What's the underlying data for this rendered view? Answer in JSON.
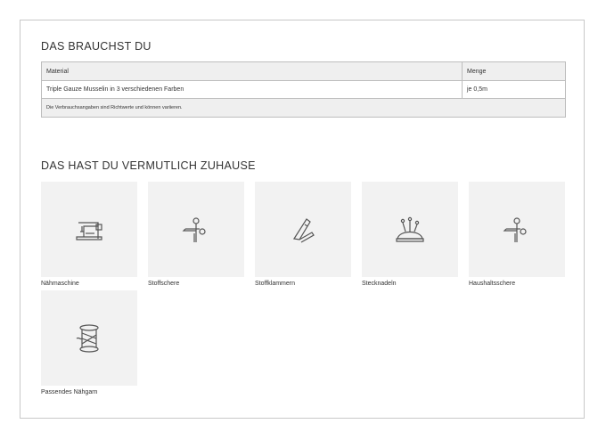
{
  "section1": {
    "title": "DAS BRAUCHST DU",
    "table": {
      "headers": [
        "Material",
        "Menge"
      ],
      "rows": [
        [
          "Triple Gauze Musselin in 3 verschiedenen Farben",
          "je 0,5m"
        ]
      ],
      "note": "Die Verbrauchsangaben sind Richtwerte und können variieren."
    }
  },
  "section2": {
    "title": "DAS HAST DU VERMUTLICH ZUHAUSE",
    "items": [
      {
        "label": "Nähmaschine",
        "icon": "sewing-machine-icon"
      },
      {
        "label": "Stoffschere",
        "icon": "scissors-icon"
      },
      {
        "label": "Stoffklammern",
        "icon": "fabric-clip-icon"
      },
      {
        "label": "Stecknadeln",
        "icon": "pincushion-icon"
      },
      {
        "label": "Haushaltsschere",
        "icon": "scissors-icon"
      },
      {
        "label": "Passendes Nähgarn",
        "icon": "thread-spool-icon"
      }
    ]
  }
}
